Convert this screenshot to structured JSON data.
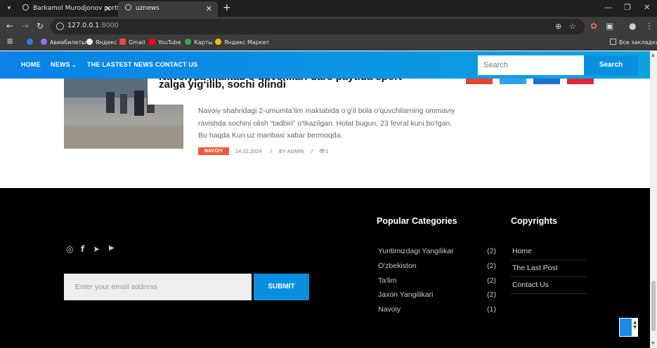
{
  "browser": {
    "tabs": [
      {
        "title": "Barkamol Murodjonov portfolio",
        "active": false
      },
      {
        "title": "uznews",
        "active": true
      }
    ],
    "url_host": "127.0.0.1",
    "url_port": ":8000",
    "bookmarks": [
      {
        "label": "Авиабилеты",
        "icon": "globe-icon"
      },
      {
        "label": "Яндекс",
        "icon": "yandex-icon"
      },
      {
        "label": "Gmail",
        "icon": "gmail-icon"
      },
      {
        "label": "YouTube",
        "icon": "youtube-icon"
      },
      {
        "label": "Карты",
        "icon": "maps-icon"
      },
      {
        "label": "Яндекс Маркет",
        "icon": "market-icon"
      }
    ],
    "all_bookmarks": "Все закладки"
  },
  "nav": {
    "items": [
      "HOME",
      "NEWS",
      "THE LASTEST NEWS",
      "CONTACT US"
    ],
    "search_placeholder": "Search",
    "search_button": "Search"
  },
  "post": {
    "title_top": "Navoiyda maktab o‘quvchilari dars paytida sport",
    "title": "zalga yig‘ilib, sochi olindi",
    "excerpt": "Navoiy shahridagi 2-umumta’lim maktabida o‘g‘il bola o‘quvchilarning ommaviy ravishda sochini olish “tadbiri” o‘tkazilgan. Holat bugun, 23 fevral kuni bo‘lgan. Bu haqda Kun.uz manbasi xabar bermoqda.",
    "category": "NAVOIY",
    "date": "24.02.2024",
    "sep": "/",
    "author": "BY ADMIN",
    "views": "1"
  },
  "footer": {
    "email_placeholder": "Enter your email address",
    "submit": "SUBMIT",
    "popular_title": "Popular Categories",
    "categories": [
      {
        "name": "Yuritimizdagi Yangilikar",
        "count": "(2)"
      },
      {
        "name": "O'zbekiston",
        "count": "(2)"
      },
      {
        "name": "Ta'lim",
        "count": "(2)"
      },
      {
        "name": "Jaxon Yangilikari",
        "count": "(2)"
      },
      {
        "name": "Navoiy",
        "count": "(1)"
      }
    ],
    "copyrights_title": "Copyrights",
    "copyright_links": [
      "Home",
      "The Last Post",
      "Contact Us"
    ],
    "social_icons": [
      "instagram-icon",
      "facebook-icon",
      "telegram-icon",
      "youtube-icon"
    ]
  },
  "colors": {
    "accent": "#0a8fe0",
    "badge": "#f05a3a",
    "footer_bg": "#000000"
  }
}
